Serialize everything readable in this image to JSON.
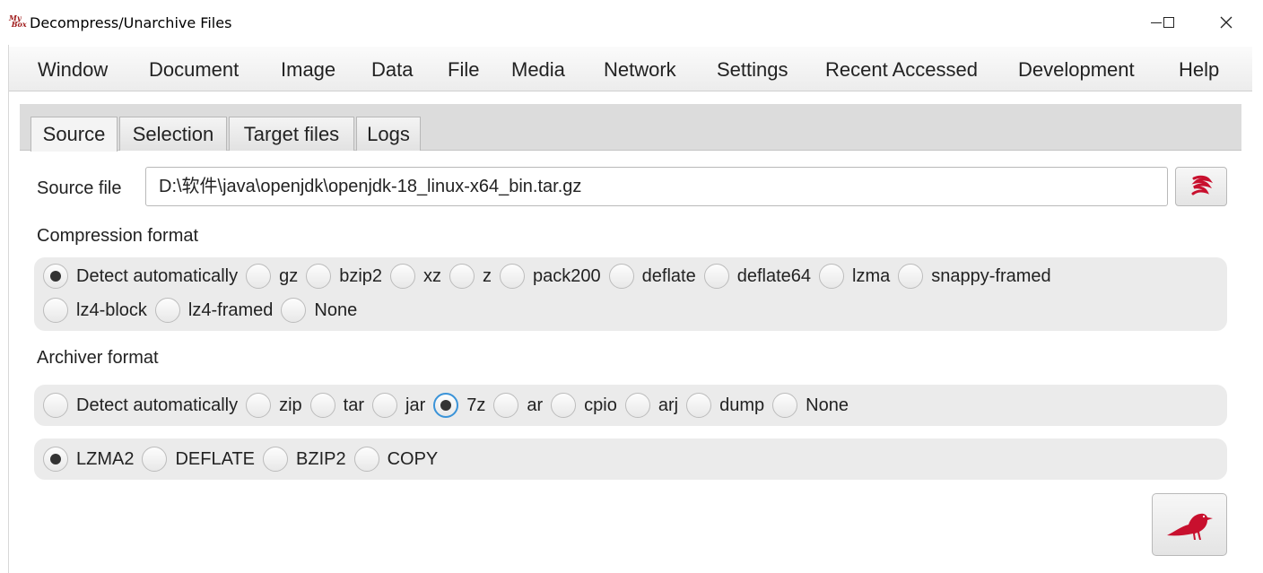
{
  "window": {
    "logo_text": "My Box",
    "title": "Decompress/Unarchive Files",
    "minimize_symbol": "–",
    "close_symbol": "✕"
  },
  "menu": {
    "items": [
      "Window",
      "Document",
      "Image",
      "Data",
      "File",
      "Media",
      "Network",
      "Settings",
      "Recent Accessed",
      "Development",
      "Help"
    ]
  },
  "tabs": [
    {
      "label": "Source",
      "active": true
    },
    {
      "label": "Selection",
      "active": false
    },
    {
      "label": "Target files",
      "active": false
    },
    {
      "label": "Logs",
      "active": false
    }
  ],
  "source": {
    "label": "Source file",
    "value": "D:\\软件\\java\\openjdk\\openjdk-18_linux-x64_bin.tar.gz",
    "picker_icon": "file-picker-icon"
  },
  "compression": {
    "label": "Compression format",
    "options": [
      "Detect automatically",
      "gz",
      "bzip2",
      "xz",
      "z",
      "pack200",
      "deflate",
      "deflate64",
      "lzma",
      "snappy-framed",
      "lz4-block",
      "lz4-framed",
      "None"
    ],
    "selected": "Detect automatically"
  },
  "archiver": {
    "label": "Archiver format",
    "options": [
      "Detect automatically",
      "zip",
      "tar",
      "jar",
      "7z",
      "ar",
      "cpio",
      "arj",
      "dump",
      "None"
    ],
    "selected": "7z"
  },
  "sevenz_method": {
    "options": [
      "LZMA2",
      "DEFLATE",
      "BZIP2",
      "COPY"
    ],
    "selected": "LZMA2"
  },
  "colors": {
    "accent": "#c8102e",
    "focus": "#3a93d8"
  },
  "run_icon": "bird-icon"
}
